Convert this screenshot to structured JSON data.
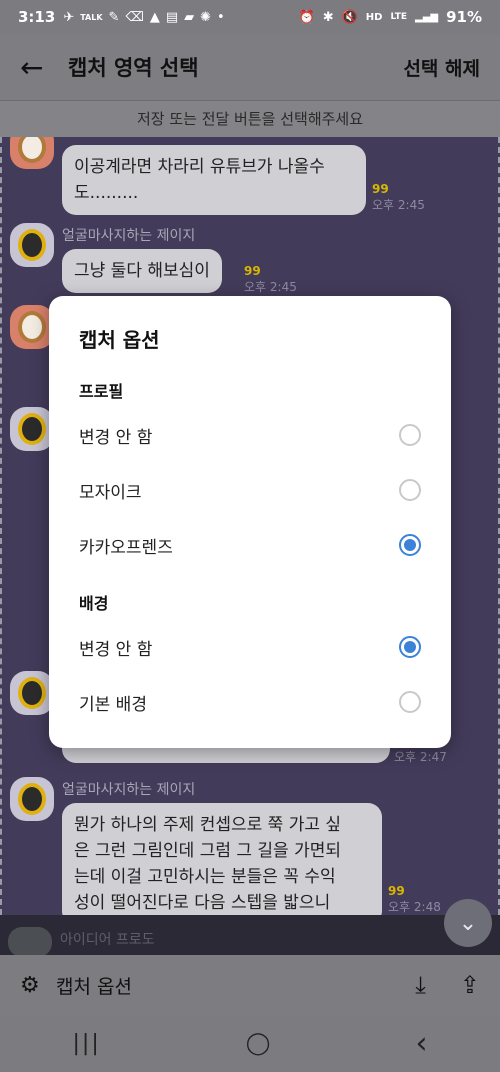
{
  "status_bar": {
    "time": "3:13",
    "notifications": [
      "✈",
      "TALK",
      "✎",
      "⌫",
      "▲",
      "▤",
      "▰",
      "✺",
      "•"
    ],
    "right_icons": [
      "⏰",
      "✱",
      "🔇",
      "HD",
      "LTE",
      "▂▄▆"
    ],
    "battery": "91%"
  },
  "app_bar": {
    "back_icon": "←",
    "title": "캡처 영역 선택",
    "deselect": "선택 해제"
  },
  "hint": "저장 또는 전달 버튼을 선택해주세요",
  "chat": {
    "messages": [
      {
        "sender": "",
        "text_line1": "이공계라면 차라리 유튜브가 나올수",
        "text_line2": "도.........",
        "read": "99",
        "time": "오후 2:45"
      },
      {
        "sender": "얼굴마사지하는 제이지",
        "text_line1": "그냥 둘다 해보심이",
        "read": "99",
        "time": "오후 2:45"
      },
      {
        "sender": "",
        "time": "오후 2:47"
      },
      {
        "sender": "얼굴마사지하는 제이지",
        "text_line1": "뭔가 하나의 주제 컨셉으로 쭉 가고 싶",
        "text_line2": "은 그런 그림인데 그럼 그 길을 가면되",
        "text_line3": "는데 이걸 고민하시는 분들은 꼭 수익",
        "text_line4": "성이 떨어진다로 다음 스텝을 밟으니",
        "read": "99",
        "time": "오후 2:48"
      }
    ],
    "peek_sender": "아이디어 프로도"
  },
  "dialog": {
    "title": "캡처 옵션",
    "profile_section": "프로필",
    "profile_options": [
      {
        "label": "변경 안 함",
        "selected": false
      },
      {
        "label": "모자이크",
        "selected": false
      },
      {
        "label": "카카오프렌즈",
        "selected": true
      }
    ],
    "background_section": "배경",
    "background_options": [
      {
        "label": "변경 안 함",
        "selected": true
      },
      {
        "label": "기본 배경",
        "selected": false
      }
    ]
  },
  "fab_icon": "⌄",
  "bottom_bar": {
    "options_icon": "⚙",
    "options_label": "캡처 옵션",
    "download_icon": "⤓",
    "share_icon": "⇪"
  },
  "nav_bar": {
    "recents": "|||",
    "home": "◯",
    "back": "‹"
  },
  "colors": {
    "accent": "#3b82d8",
    "chat_bg": "#433b5a",
    "read_count": "#d8b700"
  }
}
